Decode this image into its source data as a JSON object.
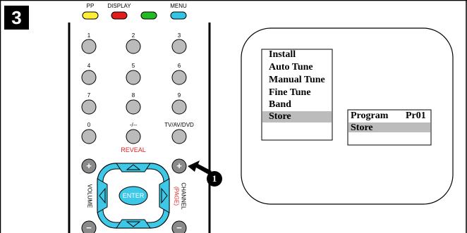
{
  "step": {
    "number": "3"
  },
  "remote": {
    "color_buttons": [
      {
        "label": "PP",
        "color": "#ffee33"
      },
      {
        "label": "DISPLAY",
        "color": "#e01c1c"
      },
      {
        "label": "",
        "color": "#22bb22"
      },
      {
        "label": "MENU",
        "color": "#33c4e4"
      }
    ],
    "keypad": [
      "1",
      "2",
      "3",
      "4",
      "5",
      "6",
      "7",
      "8",
      "9",
      "0",
      "-/--",
      "TV/AV/DVD"
    ],
    "reveal_label": "REVEAL",
    "volume_label": "VOLUME",
    "channel_label": "CHANNEL",
    "page_label": "(PAGE)",
    "enter_label": "ENTER",
    "plus_symbol": "+",
    "minus_symbol": "−",
    "callout_number": "1",
    "dpad_color": "#3cc8e6",
    "button_gray": "#bbbbbb"
  },
  "tv_screen": {
    "menu_items": [
      "Install",
      "Auto Tune",
      "Manual Tune",
      "Fine Tune",
      "Band",
      "Store"
    ],
    "selected_index": 5,
    "submenu": {
      "title": "Program",
      "value": "Pr01",
      "selected_item": "Store"
    }
  }
}
